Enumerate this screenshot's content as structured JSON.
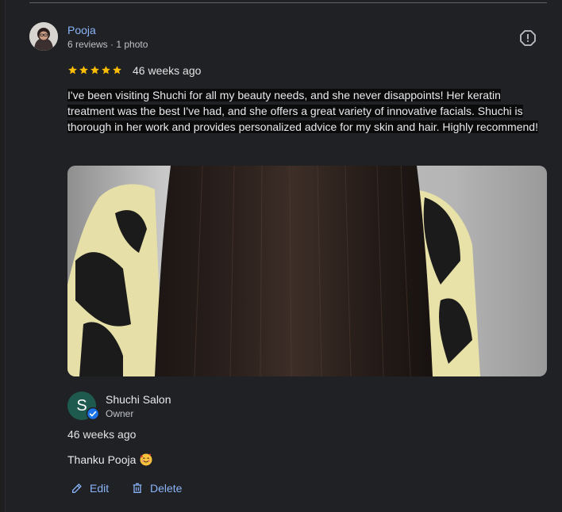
{
  "review": {
    "reviewer_name": "Pooja",
    "reviewer_meta": "6 reviews · 1 photo",
    "rating": 5,
    "age": "46 weeks ago",
    "text": "I've been visiting Shuchi for all my beauty needs, and she never disappoints! Her keratin treatment was the best I've had, and she offers a great variety of innovative facials. Shuchi is thorough in her work and provides personalized advice for my skin and hair. Highly recommend!"
  },
  "owner_reply": {
    "avatar_letter": "S",
    "name": "Shuchi Salon",
    "role": "Owner",
    "age": "46 weeks ago",
    "text": "Thanku Pooja"
  },
  "actions": {
    "edit_label": "Edit",
    "delete_label": "Delete"
  },
  "icons": {
    "report": "report-icon",
    "star": "star-icon",
    "verified": "verified-badge-icon",
    "emoji": "smiling-face-with-hearts-emoji",
    "edit": "pencil-icon",
    "delete": "trash-icon"
  },
  "colors": {
    "link": "#8ab4f8",
    "star": "#fbbc04",
    "owner_avatar": "#1e5b4e",
    "verified": "#1a73e8"
  }
}
